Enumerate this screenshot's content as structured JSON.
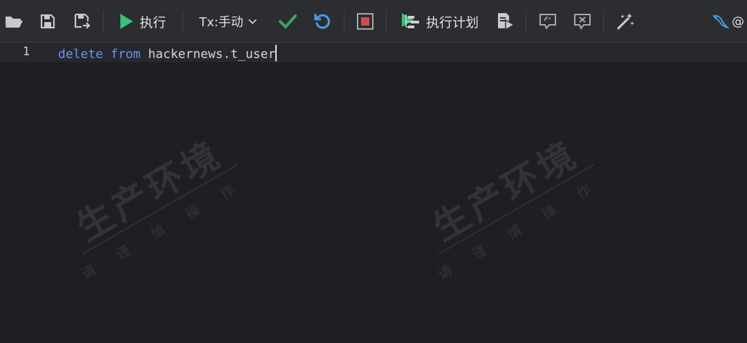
{
  "toolbar": {
    "run_label": "执行",
    "tx_label": "Tx:手动",
    "explain_label": "执行计划",
    "connection_label": "@"
  },
  "editor": {
    "line_number": "1",
    "keyword_delete": "delete",
    "keyword_from": "from",
    "table_name": "hackernews.t_user"
  },
  "watermark": {
    "title": "生产环境",
    "subtitle": "请谨慎操作"
  },
  "colors": {
    "run_green": "#3ec07a",
    "check_green": "#3aa56b",
    "undo_blue": "#4a9be0",
    "stop_red": "#c94f4f",
    "keyword_blue": "#6b98e0"
  }
}
